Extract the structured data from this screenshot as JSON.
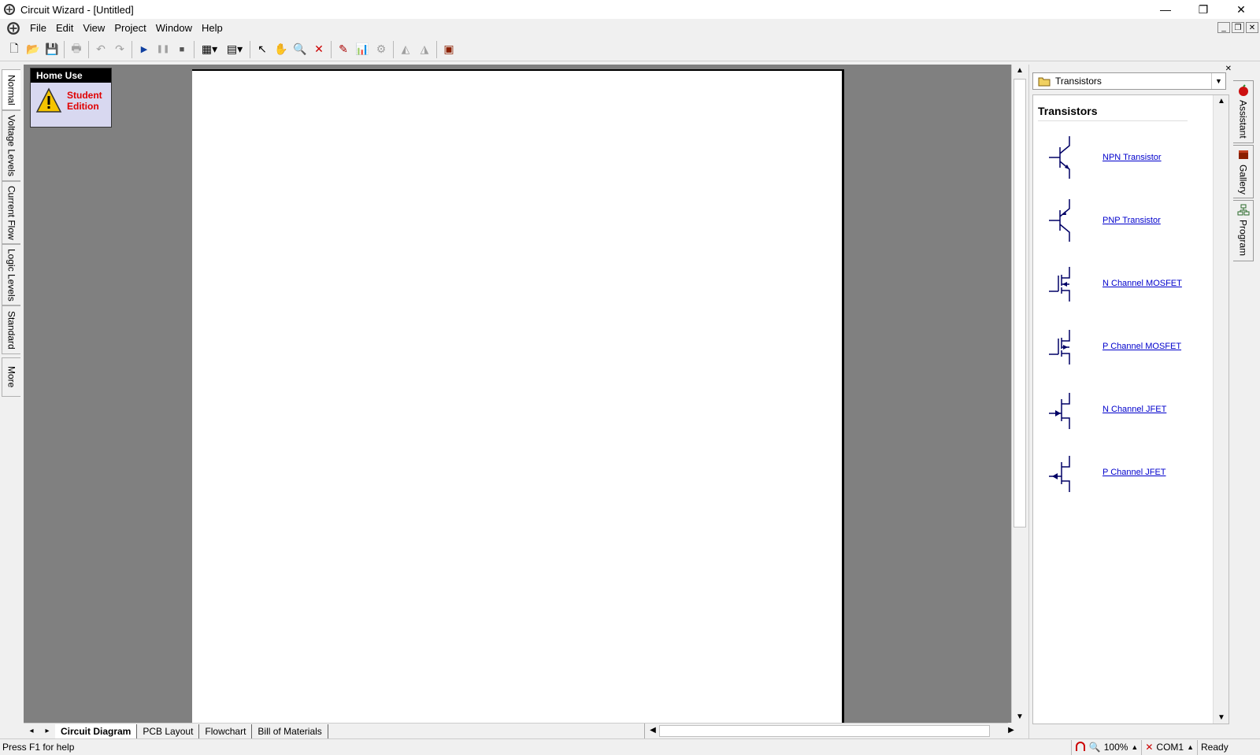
{
  "window": {
    "title": "Circuit Wizard - [Untitled]",
    "minimize": "—",
    "restore": "❐",
    "close": "✕"
  },
  "menu": {
    "items": [
      "File",
      "Edit",
      "View",
      "Project",
      "Window",
      "Help"
    ]
  },
  "left_tabs": {
    "items": [
      "Normal",
      "Voltage Levels",
      "Current Flow",
      "Logic Levels",
      "Standard",
      "More"
    ]
  },
  "home_box": {
    "header": "Home Use",
    "edition_line1": "Student",
    "edition_line2": "Edition"
  },
  "bottom_tabs": {
    "items": [
      "Circuit Diagram",
      "PCB Layout",
      "Flowchart",
      "Bill of Materials"
    ]
  },
  "right_panel": {
    "combo_value": "Transistors",
    "heading": "Transistors",
    "items": [
      "NPN Transistor",
      "PNP Transistor",
      "N Channel MOSFET",
      "P Channel MOSFET",
      "N Channel JFET",
      "P Channel JFET"
    ]
  },
  "right_tabs": {
    "items": [
      "Assistant",
      "Gallery",
      "Program"
    ]
  },
  "status": {
    "help": "Press F1 for help",
    "zoom": "100%",
    "port": "COM1",
    "state": "Ready"
  },
  "colors": {
    "canvas_bg": "#808080",
    "link": "#0000cc",
    "edition_red": "#e00000",
    "symbol_navy": "#000066"
  }
}
